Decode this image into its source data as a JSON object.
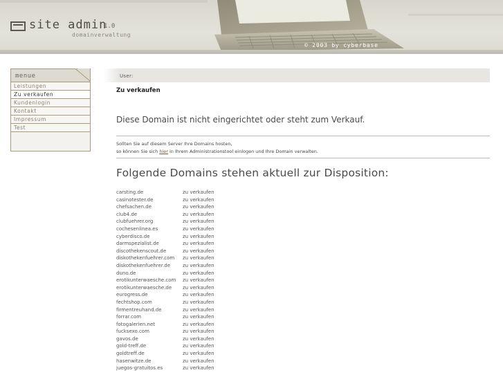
{
  "header": {
    "logo_text": "site admin",
    "version": "1.0",
    "subtitle": "domainverwaltung",
    "copyright": "© 2003 by cyberbase"
  },
  "menu": {
    "title": "menue",
    "items": [
      {
        "label": "Leistungen",
        "active": false
      },
      {
        "label": "Zu verkaufen",
        "active": true
      },
      {
        "label": "Kundenlogin",
        "active": false
      },
      {
        "label": "Kontakt",
        "active": false
      },
      {
        "label": "Impressum",
        "active": false
      },
      {
        "label": "Test",
        "active": false
      }
    ]
  },
  "main": {
    "user_label": "User:",
    "section_title": "Zu verkaufen",
    "headline": "Diese Domain ist nicht eingerichtet oder steht zum Verkauf.",
    "info_line1": "Sollten Sie auf diesem Server Ihre Domains hosten,",
    "info_line2_pre": "so können Sie sich ",
    "info_link": "hier",
    "info_line2_post": " in Ihrem Administrationstool einlogen und Ihre Domain verwalten.",
    "domains_heading": "Folgende Domains stehen aktuell zur Disposition:",
    "domains": [
      {
        "name": "carsting.de",
        "status": "zu verkaufen"
      },
      {
        "name": "casinotester.de",
        "status": "zu verkaufen"
      },
      {
        "name": "chefsachen.de",
        "status": "zu verkaufen"
      },
      {
        "name": "club4.de",
        "status": "zu verkaufen"
      },
      {
        "name": "clubfuehrer.org",
        "status": "zu verkaufen"
      },
      {
        "name": "cochesenlinea.es",
        "status": "zu verkaufen"
      },
      {
        "name": "cyberdisco.de",
        "status": "zu verkaufen"
      },
      {
        "name": "darmspezialist.de",
        "status": "zu verkaufen"
      },
      {
        "name": "discothekenscout.de",
        "status": "zu verkaufen"
      },
      {
        "name": "diskothekenfuehrer.com",
        "status": "zu verkaufen"
      },
      {
        "name": "diskothekenfuehrer.de",
        "status": "zu verkaufen"
      },
      {
        "name": "duno.de",
        "status": "zu verkaufen"
      },
      {
        "name": "erotikunterwaesche.com",
        "status": "zu verkaufen"
      },
      {
        "name": "erotikunterwaesche.de",
        "status": "zu verkaufen"
      },
      {
        "name": "eurogress.de",
        "status": "zu verkaufen"
      },
      {
        "name": "fechtshop.com",
        "status": "zu verkaufen"
      },
      {
        "name": "firmentreuhand.de",
        "status": "zu verkaufen"
      },
      {
        "name": "forrar.com",
        "status": "zu verkaufen"
      },
      {
        "name": "fotogalerien.net",
        "status": "zu verkaufen"
      },
      {
        "name": "fucksexo.com",
        "status": "zu verkaufen"
      },
      {
        "name": "gavos.de",
        "status": "zu verkaufen"
      },
      {
        "name": "gold-treff.de",
        "status": "zu verkaufen"
      },
      {
        "name": "goldtreff.de",
        "status": "zu verkaufen"
      },
      {
        "name": "hasenwitze.de",
        "status": "zu verkaufen"
      },
      {
        "name": "juegos-gratuitos.es",
        "status": "zu verkaufen"
      }
    ]
  }
}
